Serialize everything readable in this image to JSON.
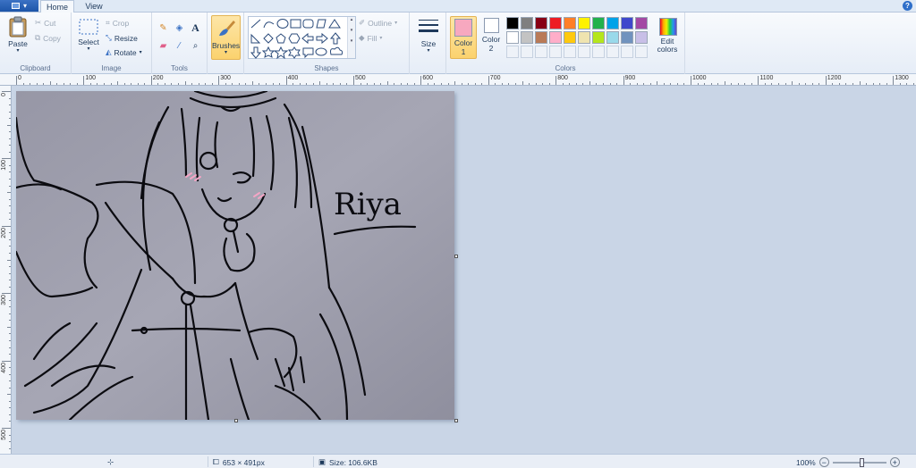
{
  "tabs": {
    "file": "File menu",
    "home": "Home",
    "view": "View"
  },
  "clipboard": {
    "label": "Clipboard",
    "paste": "Paste",
    "cut": "Cut",
    "copy": "Copy"
  },
  "image": {
    "label": "Image",
    "select": "Select",
    "crop": "Crop",
    "resize": "Resize",
    "rotate": "Rotate"
  },
  "tools": {
    "label": "Tools",
    "text_glyph": "A"
  },
  "brushes": {
    "label": "Brushes"
  },
  "shapes": {
    "label": "Shapes",
    "outline": "Outline",
    "fill": "Fill"
  },
  "size": {
    "label": "Size"
  },
  "colors": {
    "label": "Colors",
    "color1": "Color\n1",
    "color1_value": "#f7a8bf",
    "color2": "Color\n2",
    "color2_value": "#ffffff",
    "edit": "Edit colors",
    "palette_row1": [
      "#000000",
      "#7f7f7f",
      "#880015",
      "#ed1c24",
      "#ff7f27",
      "#fff200",
      "#22b14c",
      "#00a2e8",
      "#3f48cc",
      "#a349a4"
    ],
    "palette_row2": [
      "#ffffff",
      "#c3c3c3",
      "#b97a57",
      "#ffaec9",
      "#ffc90e",
      "#efe4b0",
      "#b5e61d",
      "#99d9ea",
      "#7092be",
      "#c8bfe7"
    ]
  },
  "ruler_h": [
    "0",
    "100",
    "200",
    "300",
    "400",
    "500",
    "600",
    "700",
    "800",
    "900",
    "1000",
    "1100",
    "1200",
    "1300"
  ],
  "ruler_v": [
    "0",
    "100",
    "200",
    "300",
    "400",
    "500"
  ],
  "drawing": {
    "signature": "Riya"
  },
  "status": {
    "dimensions": "653 × 491px",
    "filesize": "Size: 106.6KB",
    "zoom": "100%"
  }
}
